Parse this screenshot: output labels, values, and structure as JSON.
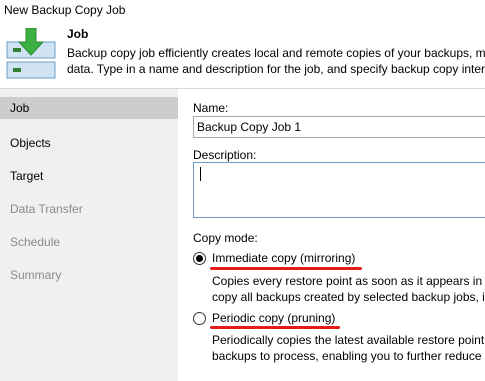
{
  "window": {
    "title": "New Backup Copy Job"
  },
  "header": {
    "title": "Job",
    "desc_line1": "Backup copy job efficiently creates local and remote copies of your backups, m",
    "desc_line2": "data. Type in a name and description for the job, and specify backup copy interv"
  },
  "sidebar": {
    "items": [
      {
        "label": "Job",
        "state": "active"
      },
      {
        "label": "Objects",
        "state": "enabled"
      },
      {
        "label": "Target",
        "state": "enabled"
      },
      {
        "label": "Data Transfer",
        "state": "disabled"
      },
      {
        "label": "Schedule",
        "state": "disabled"
      },
      {
        "label": "Summary",
        "state": "disabled"
      }
    ]
  },
  "form": {
    "name_label": "Name:",
    "name_value": "Backup Copy Job 1",
    "description_label": "Description:",
    "description_value": "",
    "copy_mode_label": "Copy mode:",
    "immediate": {
      "label": "Immediate copy (mirroring)",
      "selected": true,
      "desc_line1": "Copies every restore point as soon as it appears in th",
      "desc_line2": "copy all backups created by selected backup jobs, in"
    },
    "periodic": {
      "label": "Periodic copy (pruning)",
      "selected": false,
      "desc_line1": "Periodically copies the latest available restore point o",
      "desc_line2": "backups to process, enabling you to further reduce l"
    }
  },
  "colors": {
    "annotation": "#e31b1b",
    "active_sidebar": "#cdcdcd",
    "icon_green": "#3cb043",
    "icon_blue": "#7fb2dc"
  },
  "icons": {
    "header": "backup-copy-icon"
  }
}
